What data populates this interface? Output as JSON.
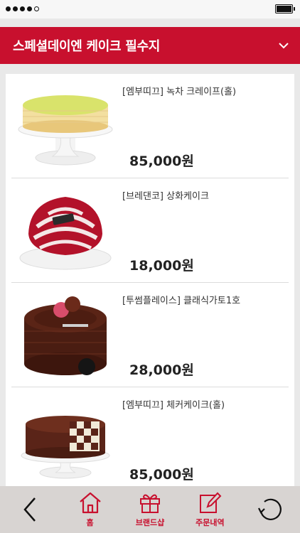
{
  "header": {
    "title": "스페셜데이엔 케이크 필수지"
  },
  "products": [
    {
      "name": "[엠부띠끄] 녹차 크레이프(홀)",
      "price": "85,000원"
    },
    {
      "name": "[브레댄코] 상화케이크",
      "price": "18,000원"
    },
    {
      "name": "[투썸플레이스] 클래식가토1호",
      "price": "28,000원"
    },
    {
      "name": "[엠부띠끄] 체커케이크(홀)",
      "price": "85,000원"
    }
  ],
  "nav": {
    "home": "홈",
    "brand_shop": "브랜드샵",
    "orders": "주문내역"
  },
  "colors": {
    "accent": "#c8102e",
    "nav_bg": "#d8d4d2"
  }
}
